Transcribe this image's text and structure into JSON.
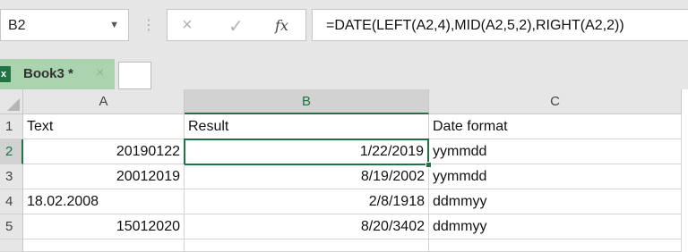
{
  "formula_bar": {
    "name_box": "B2",
    "cancel_icon": "×",
    "enter_icon": "✓",
    "fx_label": "fx",
    "formula": "=DATE(LEFT(A2,4),MID(A2,5,2),RIGHT(A2,2))"
  },
  "workbook_tab": {
    "icon_letter": "x",
    "name": "Book3 *",
    "close": "×"
  },
  "columns": [
    "A",
    "B",
    "C"
  ],
  "rows": [
    "1",
    "2",
    "3",
    "4",
    "5"
  ],
  "cells": [
    [
      "Text",
      "Result",
      "Date format"
    ],
    [
      "20190122",
      "1/22/2019",
      "yymmdd"
    ],
    [
      "20012019",
      "8/19/2002",
      "yymmdd"
    ],
    [
      "18.02.2008",
      "2/8/1918",
      "ddmmyy"
    ],
    [
      "15012020",
      "8/20/3402",
      "ddmmyy"
    ]
  ],
  "selected_cell": "B2",
  "colors": {
    "accent": "#217346",
    "tab_bg": "#a9d4ae"
  }
}
